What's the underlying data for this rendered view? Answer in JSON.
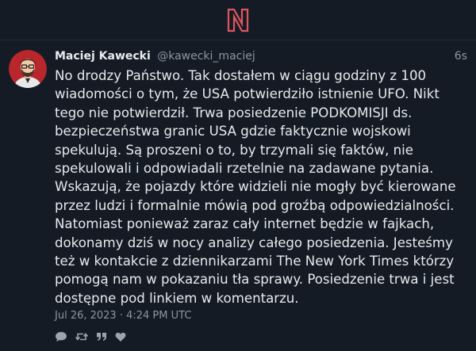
{
  "colors": {
    "background": "#141b24",
    "logo_accent": "#e0565e",
    "text": "#e6eaee",
    "muted": "#8a96a4"
  },
  "tweet": {
    "fullname": "Maciej Kawecki",
    "username": "@kawecki_maciej",
    "age": "6s",
    "content": "No drodzy Państwo. Tak dostałem w ciągu godziny z 100\nwiadomości o tym, że USA potwierdziło istnienie UFO. Nikt\ntego nie potwierdził. Trwa posiedzenie PODKOMISJI ds.\nbezpieczeństwa granic USA gdzie faktycznie wojskowi\nspekulują. Są proszeni o to, by trzymali się faktów, nie\nspekulowali i odpowiadali rzetelnie na zadawane pytania.\nWskazują, że pojazdy które widzieli nie mogły być kierowane\nprzez ludzi i formalnie mówią pod groźbą odpowiedzialności.\nNatomiast ponieważ zaraz cały internet będzie w fajkach,\ndokonamy dziś w nocy analizy całego posiedzenia. Jesteśmy\nteż w kontakcie z dziennikarzami The New York Times którzy\npomogą nam w pokazaniu tła sprawy. Posiedzenie trwa i jest\ndostępne pod linkiem w komentarzu.",
    "date": "Jul 26, 2023 · 4:24 PM UTC",
    "actions": [
      "comment-icon",
      "retweet-icon",
      "quote-icon",
      "heart-icon"
    ]
  }
}
